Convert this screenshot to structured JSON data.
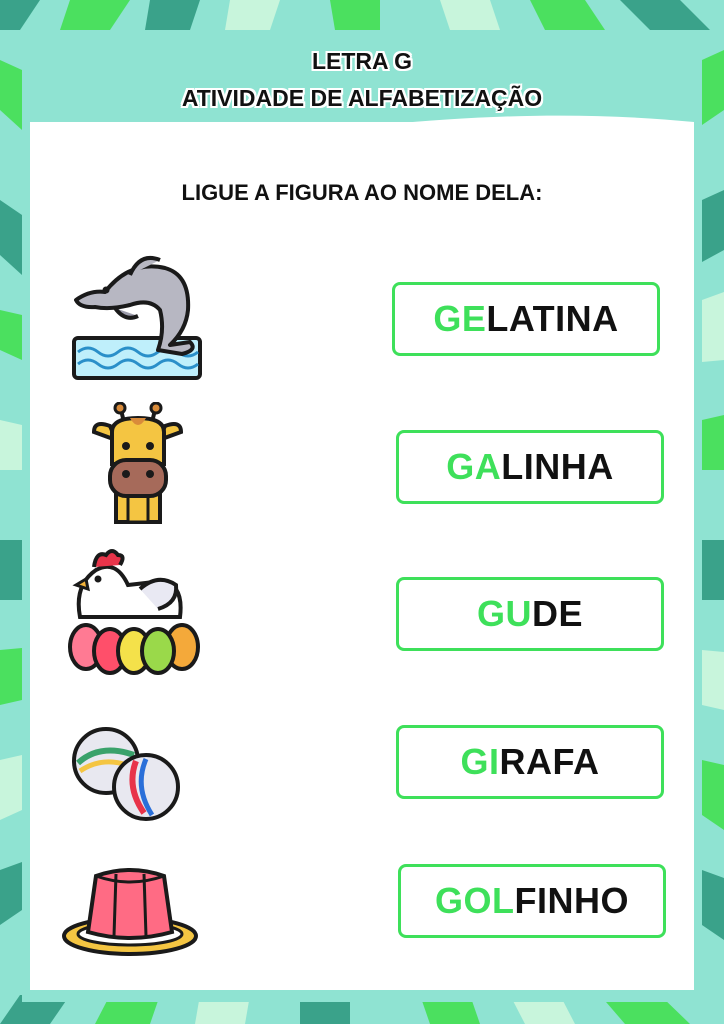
{
  "header": {
    "title_line1": "LETRA G",
    "title_line2": "ATIVIDADE DE ALFABETIZAÇÃO"
  },
  "instruction": "LIGUE A FIGURA AO NOME DELA:",
  "pictures": [
    {
      "name": "dolphin",
      "icon": "dolphin-icon"
    },
    {
      "name": "giraffe",
      "icon": "giraffe-icon"
    },
    {
      "name": "hen",
      "icon": "hen-with-eggs-icon"
    },
    {
      "name": "marbles",
      "icon": "marbles-icon"
    },
    {
      "name": "gelatin",
      "icon": "gelatin-icon"
    }
  ],
  "words": [
    {
      "highlight": "GE",
      "rest": "LATINA"
    },
    {
      "highlight": "GA",
      "rest": "LINHA"
    },
    {
      "highlight": "GU",
      "rest": "DE"
    },
    {
      "highlight": "GI",
      "rest": "RAFA"
    },
    {
      "highlight": "GOL",
      "rest": "FINHO"
    }
  ],
  "colors": {
    "accent_green": "#3ee05a",
    "stripe_teal": "#8fe3d2",
    "stripe_dark": "#3aa28a",
    "stripe_light": "#c8f5dc"
  }
}
